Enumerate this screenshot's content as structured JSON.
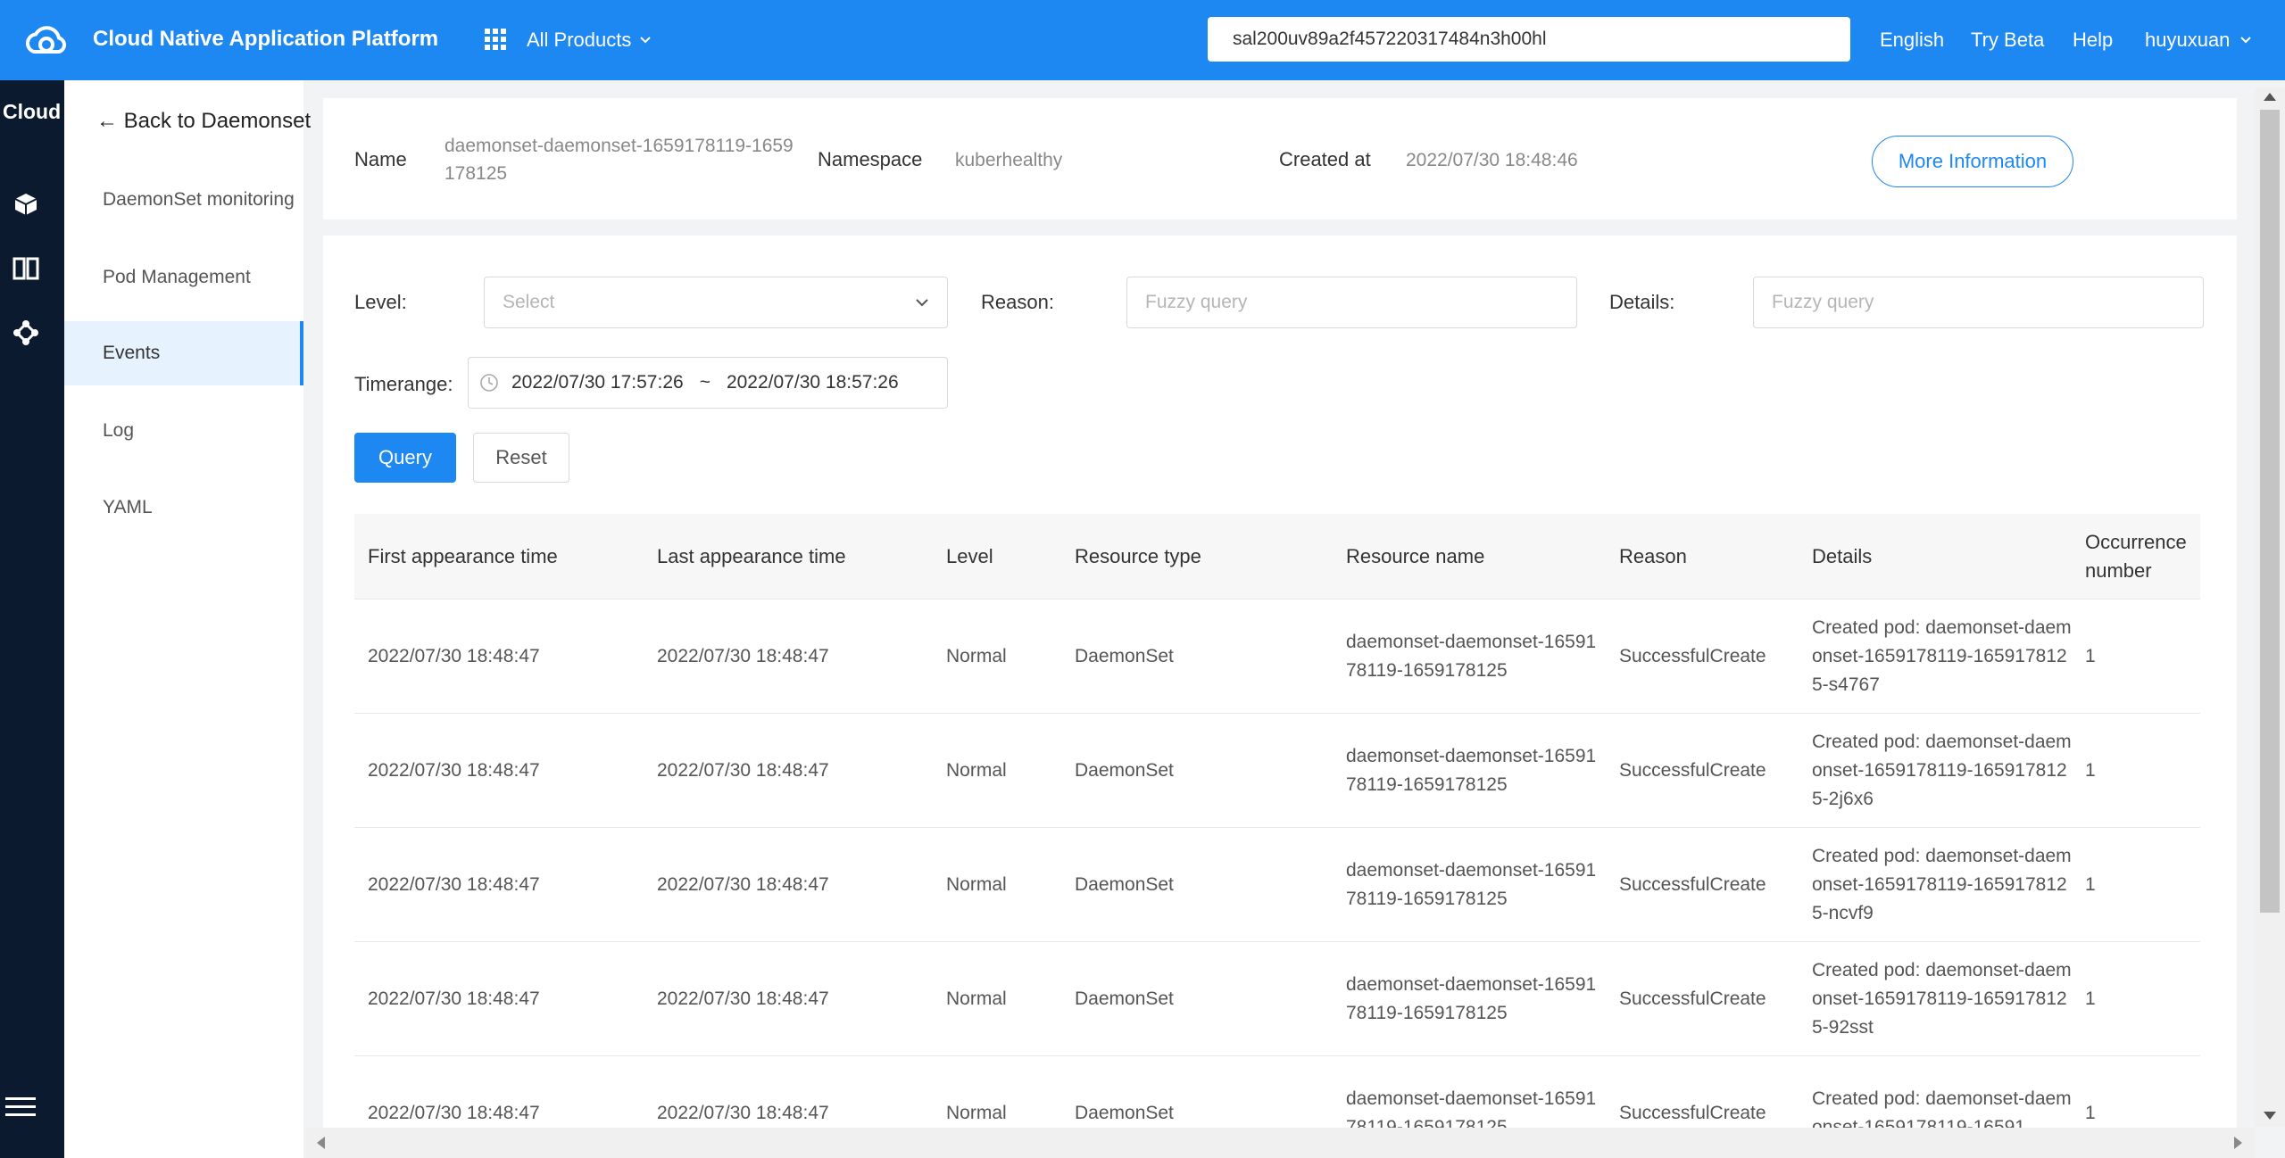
{
  "header": {
    "app_title": "Cloud Native Application Platform",
    "products_label": "All Products",
    "search_value": "sal200uv89a2f457220317484n3h00hl",
    "links": {
      "language": "English",
      "beta": "Try Beta",
      "help": "Help",
      "user": "huyuxuan"
    }
  },
  "rail": {
    "label": "Cloud",
    "icons": [
      "cube-icon",
      "columns-icon",
      "network-icon",
      "menu-icon"
    ]
  },
  "subnav": {
    "back_label": "← Back to Daemonset",
    "items": [
      {
        "label": "DaemonSet monitoring"
      },
      {
        "label": "Pod Management"
      },
      {
        "label": "Events"
      },
      {
        "label": "Log"
      },
      {
        "label": "YAML"
      }
    ],
    "active": "Events"
  },
  "info": {
    "name_label": "Name",
    "name_value": "daemonset-daemonset-1659178119-1659178125",
    "namespace_label": "Namespace",
    "namespace_value": "kuberhealthy",
    "created_label": "Created at",
    "created_value": "2022/07/30 18:48:46",
    "more_button": "More Information"
  },
  "filters": {
    "level_label": "Level",
    "level_placeholder": "Select",
    "reason_label": "Reason",
    "reason_placeholder": "Fuzzy query",
    "details_label": "Details",
    "details_placeholder": "Fuzzy query",
    "timerange_label": "Timerange",
    "time_start": "2022/07/30 17:57:26",
    "time_sep": "~",
    "time_end": "2022/07/30 18:57:26",
    "colon": ":",
    "query_button": "Query",
    "reset_button": "Reset"
  },
  "table": {
    "columns": [
      "First appearance time",
      "Last appearance time",
      "Level",
      "Resource type",
      "Resource name",
      "Reason",
      "Details",
      "Occurrence number"
    ],
    "rows": [
      [
        "2022/07/30 18:48:47",
        "2022/07/30 18:48:47",
        "Normal",
        "DaemonSet",
        "daemonset-daemonset-1659178119-1659178125",
        "SuccessfulCreate",
        "Created pod: daemonset-daemonset-1659178119-1659178125-s4767",
        "1"
      ],
      [
        "2022/07/30 18:48:47",
        "2022/07/30 18:48:47",
        "Normal",
        "DaemonSet",
        "daemonset-daemonset-1659178119-1659178125",
        "SuccessfulCreate",
        "Created pod: daemonset-daemonset-1659178119-1659178125-2j6x6",
        "1"
      ],
      [
        "2022/07/30 18:48:47",
        "2022/07/30 18:48:47",
        "Normal",
        "DaemonSet",
        "daemonset-daemonset-1659178119-1659178125",
        "SuccessfulCreate",
        "Created pod: daemonset-daemonset-1659178119-1659178125-ncvf9",
        "1"
      ],
      [
        "2022/07/30 18:48:47",
        "2022/07/30 18:48:47",
        "Normal",
        "DaemonSet",
        "daemonset-daemonset-1659178119-1659178125",
        "SuccessfulCreate",
        "Created pod: daemonset-daemonset-1659178119-1659178125-92sst",
        "1"
      ],
      [
        "2022/07/30 18:48:47",
        "2022/07/30 18:48:47",
        "Normal",
        "DaemonSet",
        "daemonset-daemonset-1659178119-1659178125",
        "SuccessfulCreate",
        "Created pod: daemonset-daemonset-1659178119-16591",
        "1"
      ]
    ]
  },
  "colors": {
    "brand": "#1e88f2",
    "rail": "#0b1a2e",
    "active_nav_bg": "#e6f3ff"
  }
}
